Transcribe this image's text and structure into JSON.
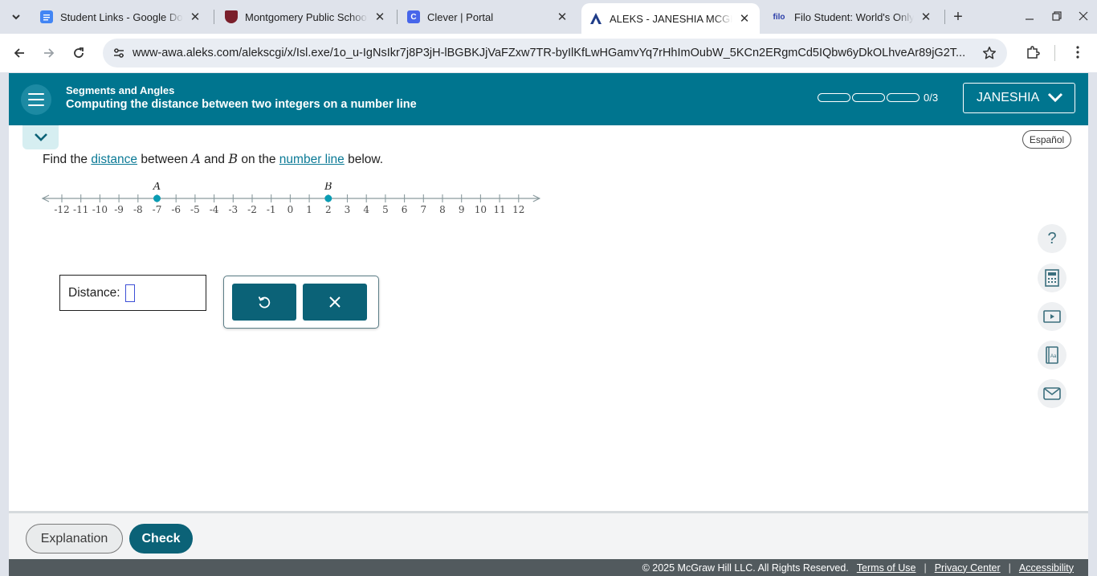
{
  "browser": {
    "tabs": [
      {
        "title": "Student Links - Google Docs",
        "favicon": "google-docs-icon",
        "active": false
      },
      {
        "title": "Montgomery Public Schools",
        "favicon": "school-crest-icon",
        "active": false
      },
      {
        "title": "Clever | Portal",
        "favicon": "clever-icon",
        "active": false
      },
      {
        "title": "ALEKS - JANESHIA MCGHEE",
        "favicon": "aleks-icon",
        "active": true
      },
      {
        "title": "Filo Student: World's Only Live",
        "favicon": "filo-icon",
        "active": false
      }
    ],
    "url": "www-awa.aleks.com/alekscgi/x/Isl.exe/1o_u-IgNsIkr7j8P3jH-lBGBKJjVaFZxw7TR-byIlKfLwHGamvYq7rHhImOubW_5KCn2ERgmCd5IQbw6yDkOLhveAr89jG2T..."
  },
  "header": {
    "topic": "Segments and Angles",
    "title": "Computing the distance between two integers on a number line",
    "progress_text": "0/3",
    "progress_segments": 3,
    "progress_filled": 0,
    "user_name": "JANESHIA"
  },
  "language_button": "Español",
  "question": {
    "prefix": "Find the ",
    "link1": "distance",
    "mid1": " between ",
    "var_a": "A",
    "mid2": " and ",
    "var_b": "B",
    "mid3": " on the ",
    "link2": "number line",
    "suffix": " below."
  },
  "number_line": {
    "min": -12,
    "max": 12,
    "ticks": [
      -12,
      -11,
      -10,
      -9,
      -8,
      -7,
      -6,
      -5,
      -4,
      -3,
      -2,
      -1,
      0,
      1,
      2,
      3,
      4,
      5,
      6,
      7,
      8,
      9,
      10,
      11,
      12
    ],
    "points": [
      {
        "label": "A",
        "value": -7
      },
      {
        "label": "B",
        "value": 2
      }
    ]
  },
  "answer": {
    "label": "Distance:",
    "value": ""
  },
  "keypad": {
    "undo_label": "↺",
    "clear_label": "✕"
  },
  "tools": [
    "help-icon",
    "calculator-icon",
    "video-icon",
    "dictionary-icon",
    "mail-icon"
  ],
  "help_glyph": "?",
  "footer": {
    "explanation_label": "Explanation",
    "check_label": "Check",
    "copyright": "© 2025 McGraw Hill LLC. All Rights Reserved.",
    "terms": "Terms of Use",
    "privacy": "Privacy Center",
    "accessibility": "Accessibility"
  }
}
